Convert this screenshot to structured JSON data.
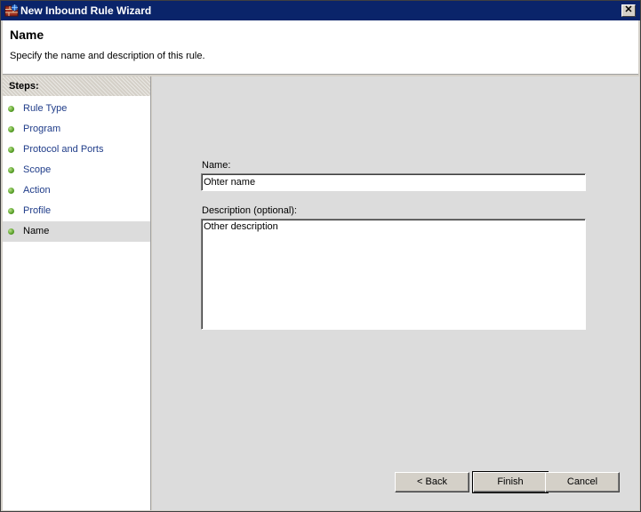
{
  "window": {
    "title": "New Inbound Rule Wizard",
    "close_glyph": "✕"
  },
  "header": {
    "title": "Name",
    "subtitle": "Specify the name and description of this rule."
  },
  "steps": {
    "heading": "Steps:",
    "items": [
      {
        "label": "Rule Type"
      },
      {
        "label": "Program"
      },
      {
        "label": "Protocol and Ports"
      },
      {
        "label": "Scope"
      },
      {
        "label": "Action"
      },
      {
        "label": "Profile"
      },
      {
        "label": "Name"
      }
    ],
    "selected": "Name"
  },
  "form": {
    "name_label": "Name:",
    "name_value": "Ohter name",
    "description_label": "Description (optional):",
    "description_value": "Other description"
  },
  "buttons": {
    "back": "< Back",
    "finish": "Finish",
    "cancel": "Cancel"
  },
  "colors": {
    "title_bar": "#0a246a",
    "step_link": "#1f3c89",
    "step_bullet": "#58a028"
  }
}
